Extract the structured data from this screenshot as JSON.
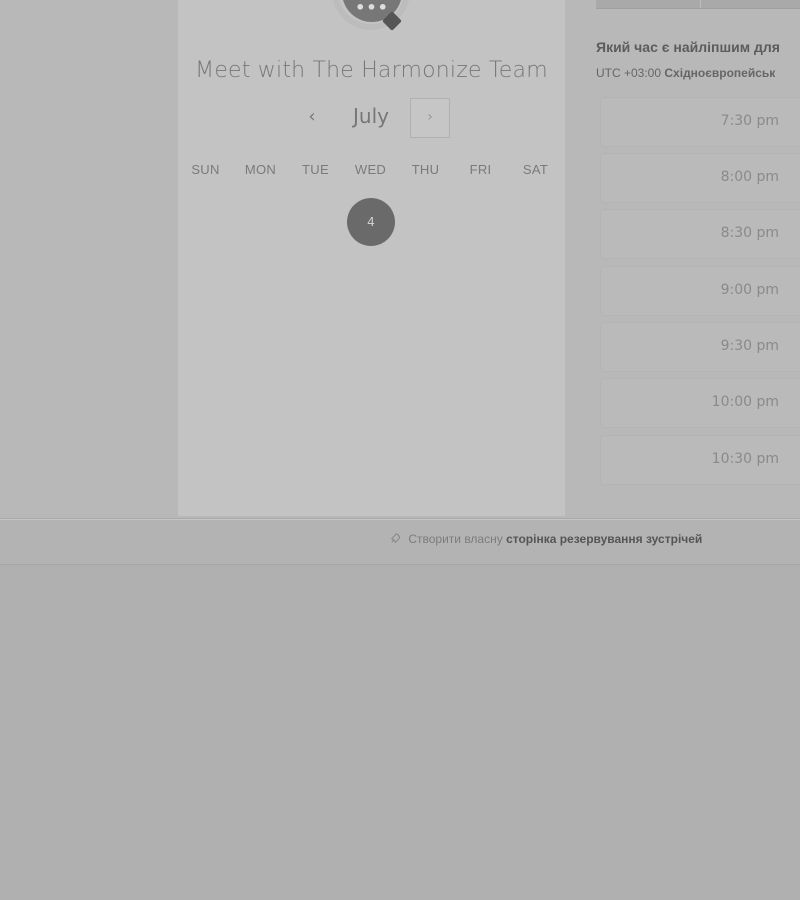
{
  "header": {
    "title": "Meet with The Harmonize Team",
    "avatar_glyph": "•••"
  },
  "calendar": {
    "month": "July",
    "prev_glyph": "‹",
    "next_glyph": "›",
    "weekdays": [
      "SUN",
      "MON",
      "TUE",
      "WED",
      "THU",
      "FRI",
      "SAT"
    ],
    "available_day": "4"
  },
  "times": {
    "question": "Який час є найліпшим для",
    "timezone_prefix": "UTC +03:00",
    "timezone_name": "Східноєвропейськ",
    "slots": [
      "7:30 pm",
      "8:00 pm",
      "8:30 pm",
      "9:00 pm",
      "9:30 pm",
      "10:00 pm",
      "10:30 pm"
    ]
  },
  "footer": {
    "icon": "rocket-icon",
    "link_prefix": "Створити власну",
    "link_strong": "сторінка резервування зустрічей"
  }
}
